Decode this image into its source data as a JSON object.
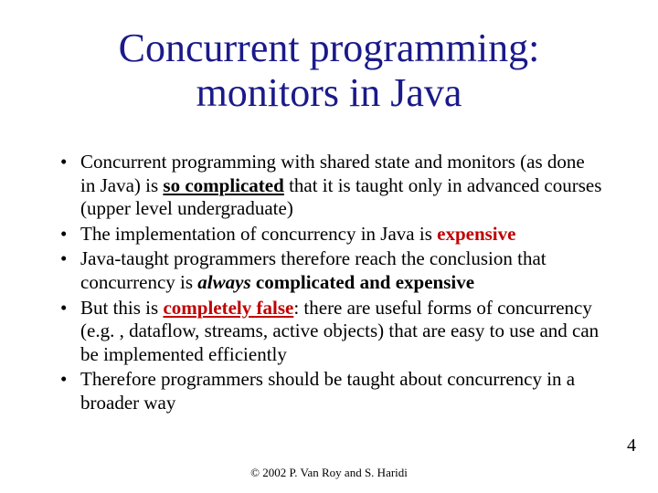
{
  "title_line1": "Concurrent programming:",
  "title_line2": "monitors in Java",
  "bullets": {
    "b1_a": "Concurrent programming with shared state and monitors (as done in Java) is ",
    "b1_emph": "so complicated",
    "b1_b": " that it is taught only in advanced courses (upper level undergraduate)",
    "b2_a": "The implementation of concurrency in Java is ",
    "b2_emph": "expensive",
    "b3_a": "Java-taught programmers therefore reach the conclusion that concurrency is ",
    "b3_emph": "always",
    "b3_b": " ",
    "b3_emph2": "complicated and expensive",
    "b4_a": "But this is ",
    "b4_emph": "completely false",
    "b4_b": ": there are useful forms of concurrency (e.g. , dataflow, streams, active objects) that are easy to use and can be implemented efficiently",
    "b5": "Therefore programmers should be taught about concurrency in a broader way"
  },
  "page_number": "4",
  "footer": "© 2002 P. Van Roy and S. Haridi"
}
